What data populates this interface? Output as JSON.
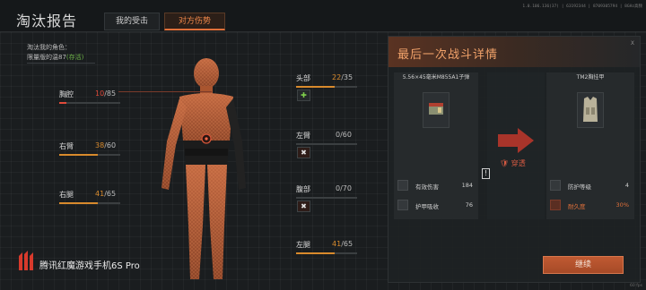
{
  "header": {
    "title": "淘汰报告",
    "tabs": [
      {
        "label": "我的受击",
        "active": false
      },
      {
        "label": "对方伤势",
        "active": true
      }
    ],
    "version_info": "1.0.106.136(37) | 63192344 | 8709305794 | 8GHz高频"
  },
  "victim": {
    "caption": "淘汰我的角色：",
    "name": "限量版的温87",
    "status": "(存活)"
  },
  "body_parts": [
    {
      "key": "chest",
      "label": "胸腔",
      "current": "10",
      "max": "/85",
      "fraction": 0.118,
      "color": "#e04a3a"
    },
    {
      "key": "right_arm",
      "label": "右臂",
      "current": "38",
      "max": "/60",
      "fraction": 0.633,
      "color": "#d88a2c"
    },
    {
      "key": "right_leg",
      "label": "右腿",
      "current": "41",
      "max": "/65",
      "fraction": 0.631,
      "color": "#d88a2c"
    },
    {
      "key": "head",
      "label": "头部",
      "current": "22",
      "max": "/35",
      "fraction": 0.629,
      "color": "#d88a2c"
    },
    {
      "key": "left_arm",
      "label": "左臂",
      "current": "0",
      "max": "/60",
      "fraction": 0,
      "color": "#bdbdbd"
    },
    {
      "key": "abdomen",
      "label": "腹部",
      "current": "0",
      "max": "/70",
      "fraction": 0,
      "color": "#bdbdbd"
    },
    {
      "key": "left_leg",
      "label": "左腿",
      "current": "41",
      "max": "/65",
      "fraction": 0.631,
      "color": "#d88a2c"
    }
  ],
  "status_icons": {
    "head": "green-bandage-icon",
    "left_arm": "fracture-icon",
    "abdomen": "fracture-icon"
  },
  "panel": {
    "title": "最后一次战斗详情",
    "close": "X",
    "ammo": {
      "name": "5.56×45毫米M855A1子弹",
      "icon": "ammo-box-icon",
      "rows": [
        {
          "label": "有效伤害",
          "value": "184",
          "icon": "bullet-icon"
        },
        {
          "label": "护甲吸收",
          "value": "76",
          "icon": "crosshair-icon"
        }
      ]
    },
    "result": "穿透",
    "armor": {
      "name": "TM2胸挂甲",
      "icon": "chest-rig-icon",
      "rows": [
        {
          "label": "防护等级",
          "value": "4",
          "icon": "vest-icon"
        },
        {
          "label": "耐久度",
          "value": "30%",
          "icon": "vest-durability-icon"
        }
      ]
    },
    "warning": "!"
  },
  "continue_label": "继续",
  "watermark": "腾讯红魔游戏手机6S Pro",
  "corner_text": "60 fps",
  "colors": {
    "accent": "#e0703a",
    "critical": "#e04a3a",
    "damaged": "#d88a2c",
    "healthy_status": "#6fb54a"
  }
}
